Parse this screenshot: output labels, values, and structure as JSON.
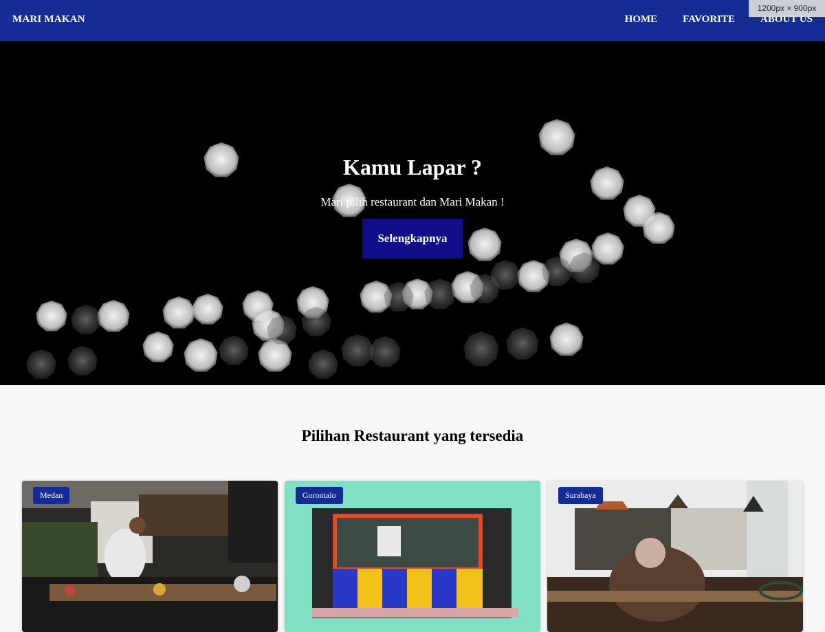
{
  "navbar": {
    "brand": "MARI MAKAN",
    "links": [
      "HOME",
      "FAVORITE",
      "ABOUT US"
    ],
    "background": "#142c94"
  },
  "viewport_badge": "1200px × 900px",
  "hero": {
    "title": "Kamu Lapar ?",
    "subtitle": "Mari pilih restaurant dan Mari Makan !",
    "button_label": "Selengkapnya",
    "button_color": "#120e8a"
  },
  "section": {
    "title": "Pilihan Restaurant yang tersedia"
  },
  "restaurants": [
    {
      "city": "Medan"
    },
    {
      "city": "Gorontalo"
    },
    {
      "city": "Surabaya"
    }
  ],
  "colors": {
    "accent": "#142c94",
    "page_background": "#f7f7f7"
  }
}
